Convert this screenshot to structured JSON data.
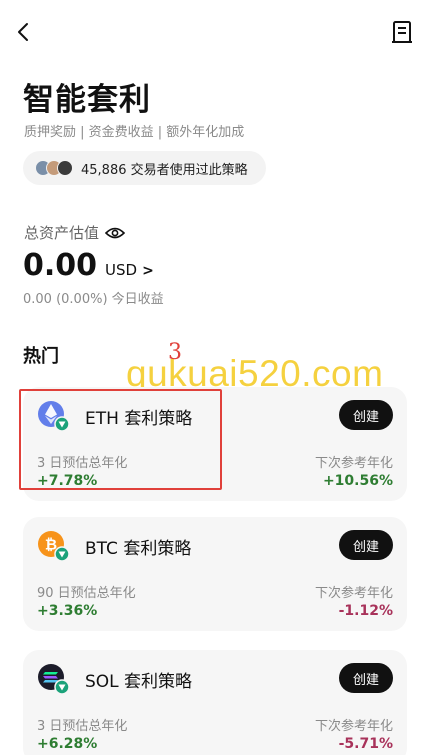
{
  "page": {
    "title": "智能套利",
    "subtitle": "质押奖励 | 资金费收益 | 额外年化加成",
    "traders_text": "45,886 交易者使用过此策略"
  },
  "assets": {
    "label": "总资产估值",
    "value": "0.00",
    "unit": "USD",
    "arrow": ">",
    "today": "0.00 (0.00%) 今日收益"
  },
  "hot": {
    "label": "热门",
    "annotation": "3",
    "watermark": "qukuai520.com"
  },
  "cards": [
    {
      "coin_icon": "eth-icon",
      "name": "ETH 套利策略",
      "button": "创建",
      "left_label": "3 日预估总年化",
      "left_value": "+7.78%",
      "right_label": "下次参考年化",
      "right_value": "+10.56%",
      "right_color": "#2e7d32"
    },
    {
      "coin_icon": "btc-icon",
      "name": "BTC 套利策略",
      "button": "创建",
      "left_label": "90 日预估总年化",
      "left_value": "+3.36%",
      "right_label": "下次参考年化",
      "right_value": "-1.12%",
      "right_color": "#a8325a"
    },
    {
      "coin_icon": "sol-icon",
      "name": "SOL 套利策略",
      "button": "创建",
      "left_label": "3 日预估总年化",
      "left_value": "+6.28%",
      "right_label": "下次参考年化",
      "right_value": "-5.71%",
      "right_color": "#a8325a"
    }
  ],
  "colors": {
    "positive": "#2e7d32",
    "negative": "#a8325a",
    "annotation": "#e0403a",
    "watermark": "#f2c200"
  }
}
